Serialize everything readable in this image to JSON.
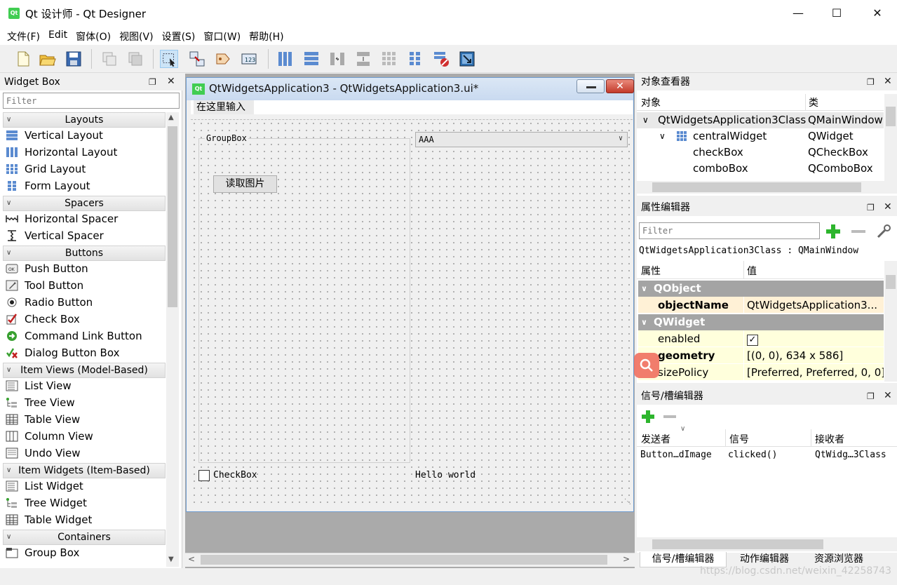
{
  "app": {
    "title": "Qt 设计师 - Qt Designer",
    "logo_text": "Qt"
  },
  "menu": [
    "文件(F)",
    "Edit",
    "窗体(O)",
    "视图(V)",
    "设置(S)",
    "窗口(W)",
    "帮助(H)"
  ],
  "widget_box": {
    "title": "Widget Box",
    "filter_placeholder": "Filter",
    "categories": {
      "layouts": "Layouts",
      "spacers": "Spacers",
      "buttons": "Buttons",
      "item_views": "Item Views (Model-Based)",
      "item_widgets": "Item Widgets (Item-Based)",
      "containers": "Containers"
    },
    "items": {
      "vertical_layout": "Vertical Layout",
      "horizontal_layout": "Horizontal Layout",
      "grid_layout": "Grid Layout",
      "form_layout": "Form Layout",
      "horizontal_spacer": "Horizontal Spacer",
      "vertical_spacer": "Vertical Spacer",
      "push_button": "Push Button",
      "tool_button": "Tool Button",
      "radio_button": "Radio Button",
      "check_box": "Check Box",
      "command_link_button": "Command Link Button",
      "dialog_button_box": "Dialog Button Box",
      "list_view": "List View",
      "tree_view": "Tree View",
      "table_view": "Table View",
      "column_view": "Column View",
      "undo_view": "Undo View",
      "list_widget": "List Widget",
      "tree_widget": "Tree Widget",
      "table_widget": "Table Widget",
      "group_box": "Group Box"
    }
  },
  "form": {
    "title": "QtWidgetsApplication3 - QtWidgetsApplication3.ui*",
    "menu_placeholder": "在这里输入",
    "groupbox_title": "GroupBox",
    "read_button": "读取图片",
    "combo_value": "AAA",
    "checkbox_label": "CheckBox",
    "label_text": "Hello world"
  },
  "object_inspector": {
    "title": "对象查看器",
    "col_object": "对象",
    "col_class": "类",
    "rows": [
      {
        "object": "QtWidgetsApplication3Class",
        "class": "QMainWindow"
      },
      {
        "object": "centralWidget",
        "class": "QWidget"
      },
      {
        "object": "checkBox",
        "class": "QCheckBox"
      },
      {
        "object": "comboBox",
        "class": "QComboBox"
      }
    ]
  },
  "property_editor": {
    "title": "属性编辑器",
    "filter_placeholder": "Filter",
    "context": "QtWidgetsApplication3Class : QMainWindow",
    "col_property": "属性",
    "col_value": "值",
    "section_qobject": "QObject",
    "section_qwidget": "QWidget",
    "object_name_key": "objectName",
    "object_name_val": "QtWidgetsApplication3...",
    "enabled_key": "enabled",
    "geometry_key": "geometry",
    "geometry_val": "[(0, 0), 634 x 586]",
    "size_policy_key": "sizePolicy",
    "size_policy_val": "[Preferred, Preferred, 0, 0]"
  },
  "signal_slot_editor": {
    "title": "信号/槽编辑器",
    "col_sender": "发送者",
    "col_signal": "信号",
    "col_receiver": "接收者",
    "row_sender": "Button…dImage",
    "row_signal": "clicked()",
    "row_receiver": "QtWidg…3Class"
  },
  "bottom_tabs": [
    "信号/槽编辑器",
    "动作编辑器",
    "资源浏览器"
  ],
  "watermark": "https://blog.csdn.net/weixin_42258743",
  "colors": {
    "qt_green": "#41cd52",
    "section_gray": "#a4a4a4",
    "highlight_yellow": "#ffffdc",
    "selected_row": "#fff1d6"
  }
}
